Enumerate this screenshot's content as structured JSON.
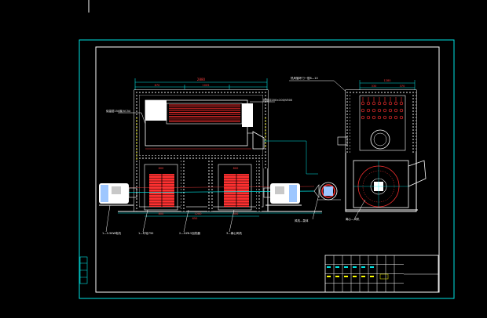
{
  "drawing": {
    "colors": {
      "background": "#000000",
      "frame": "#00e5e5",
      "outline": "#ffffff",
      "accent": "#ff3030",
      "insulation": "#ffff00",
      "annotation": "#00e5e5",
      "fill_white": "#f2f2f2"
    },
    "front_view": {
      "width_dim": "2880",
      "segment_dims": [
        "870",
        "1005"
      ],
      "callouts": [
        {
          "id": "left-top",
          "text": "保温层150厚/VC54"
        },
        {
          "id": "right-top",
          "text": "排湿口200×200/V500"
        }
      ],
      "bottom_dims": [
        "800",
        "650",
        "1200",
        "800"
      ],
      "leader_labels": [
        {
          "id": "motor-left",
          "text": "1—5.5KW电机"
        },
        {
          "id": "fan-wheel",
          "text": "1—叶轮750"
        },
        {
          "id": "heater",
          "text": "2—GZ8.5加热器"
        },
        {
          "id": "fan-right",
          "text": "3—离心风机"
        }
      ]
    },
    "side_view": {
      "top_label": "热风循环门一层8—10",
      "width_dim": "1280",
      "inner_dims": [
        "330",
        "370"
      ],
      "label_pump": "风机—泵体",
      "label_fan": "离心—风机"
    },
    "title_block": {
      "rows": 4,
      "cols": 9
    }
  }
}
